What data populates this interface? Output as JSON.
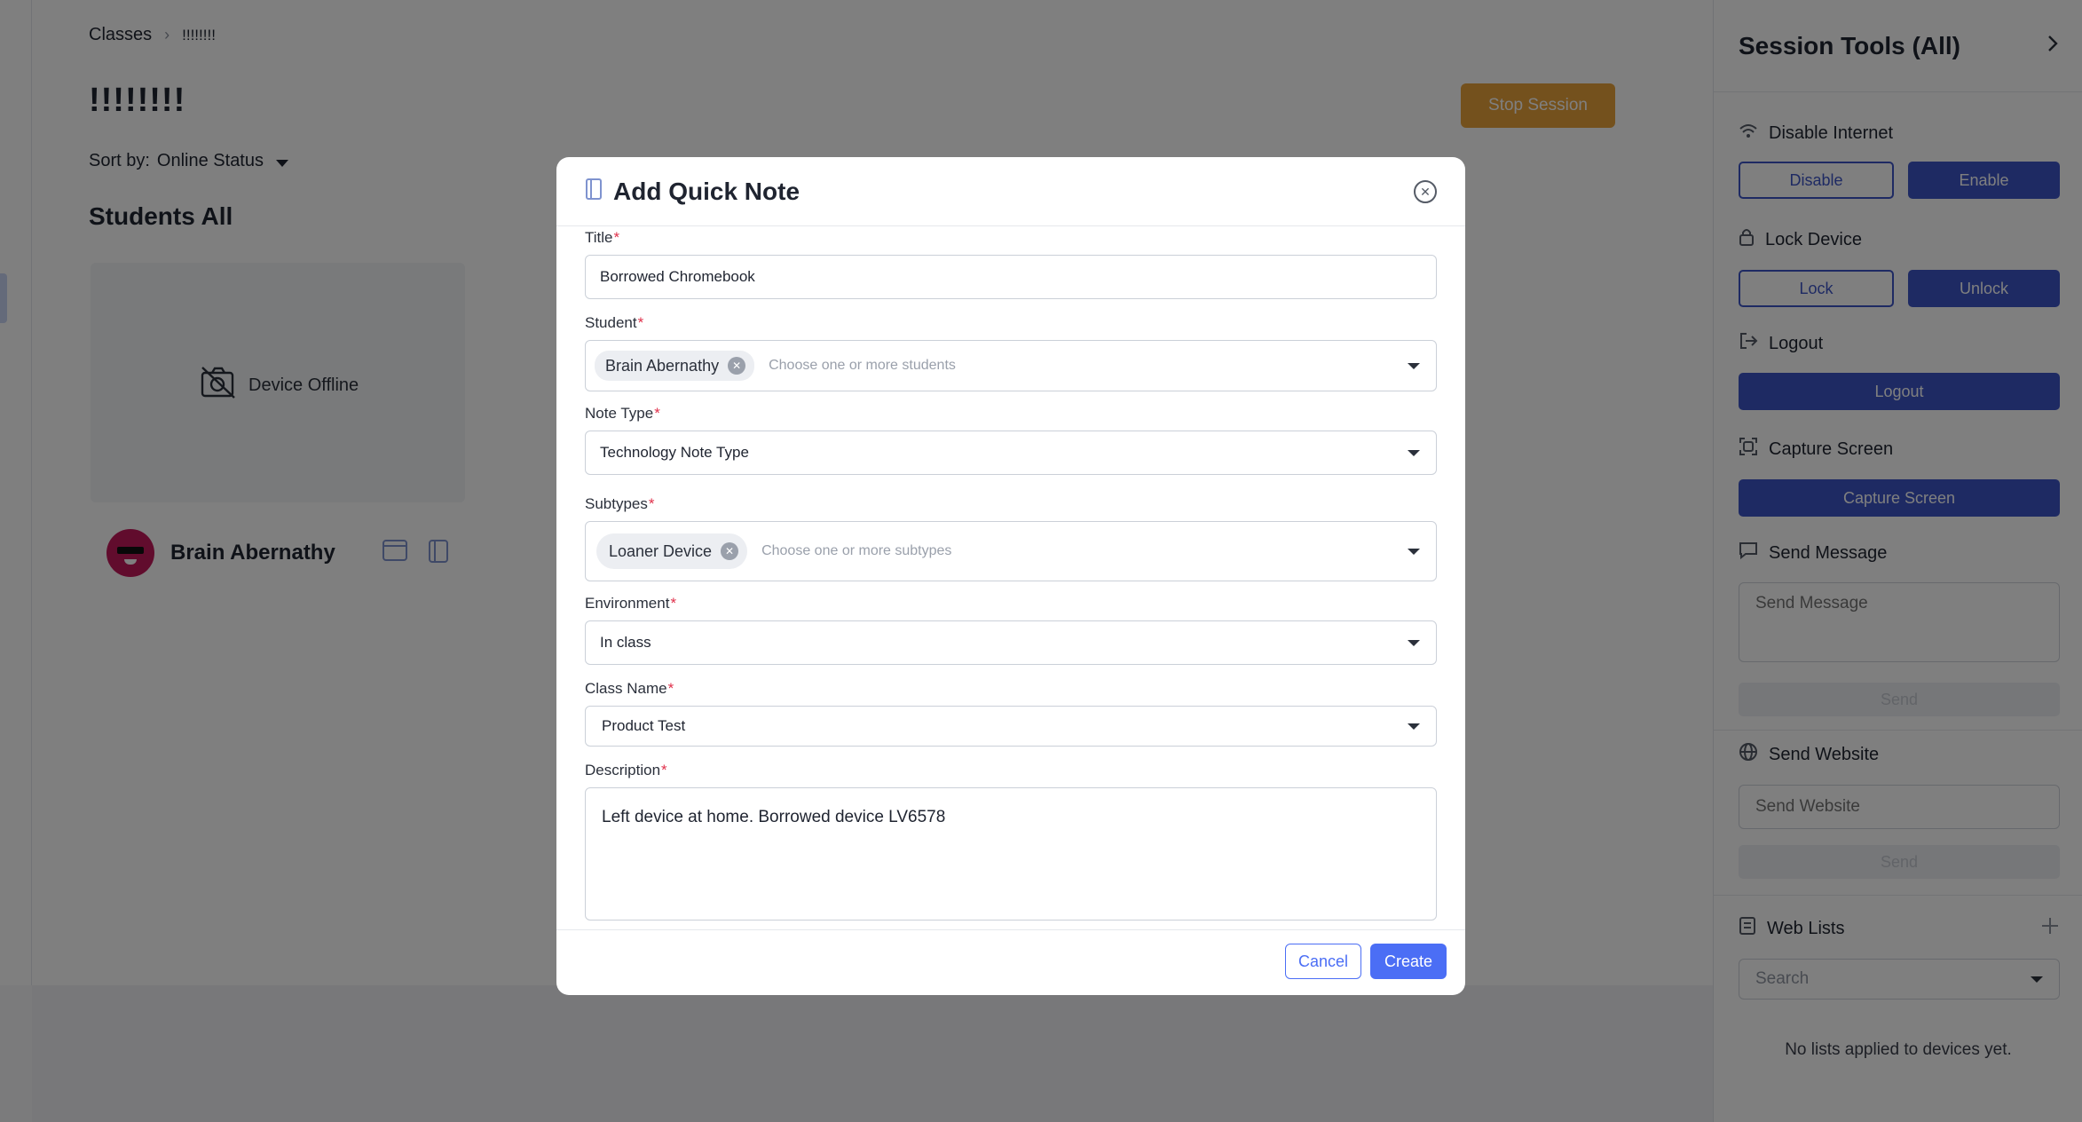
{
  "breadcrumb": {
    "root": "Classes",
    "separator": "›",
    "current": "!!!!!!!!"
  },
  "class_title": "!!!!!!!!",
  "sort": {
    "label": "Sort by:",
    "value": "Online Status"
  },
  "students_title": "Students All",
  "stop_session_label": "Stop Session",
  "student_card": {
    "status": "Device Offline",
    "name": "Brain Abernathy"
  },
  "side_panel": {
    "title": "Session Tools (All)",
    "disable_internet": {
      "label": "Disable Internet",
      "disable": "Disable",
      "enable": "Enable"
    },
    "lock_device": {
      "label": "Lock Device",
      "lock": "Lock",
      "unlock": "Unlock"
    },
    "logout": {
      "label": "Logout",
      "button": "Logout"
    },
    "capture_screen": {
      "label": "Capture Screen",
      "button": "Capture Screen"
    },
    "send_message": {
      "label": "Send Message",
      "placeholder": "Send Message",
      "button": "Send"
    },
    "send_website": {
      "label": "Send Website",
      "placeholder": "Send Website",
      "button": "Send"
    },
    "web_lists": {
      "label": "Web Lists",
      "search_placeholder": "Search",
      "empty": "No lists applied to devices yet."
    }
  },
  "modal": {
    "title": "Add Quick Note",
    "fields": {
      "title": {
        "label": "Title",
        "value": "Borrowed Chromebook"
      },
      "student": {
        "label": "Student",
        "chip": "Brain Abernathy",
        "placeholder": "Choose one or more students"
      },
      "note_type": {
        "label": "Note Type",
        "value": "Technology Note Type"
      },
      "subtypes": {
        "label": "Subtypes",
        "chip": "Loaner Device",
        "placeholder": "Choose one or more subtypes"
      },
      "environment": {
        "label": "Environment",
        "value": "In class"
      },
      "class_name": {
        "label": "Class Name",
        "value": "Product Test"
      },
      "description": {
        "label": "Description",
        "value": "Left device at home. Borrowed device LV6578"
      }
    },
    "required_marker": "*",
    "cancel_label": "Cancel",
    "create_label": "Create"
  },
  "colors": {
    "primary": "#3c55c7",
    "accent_button": "#4b6ef5",
    "stop_session": "#e9a23b",
    "required": "#e0314b"
  }
}
